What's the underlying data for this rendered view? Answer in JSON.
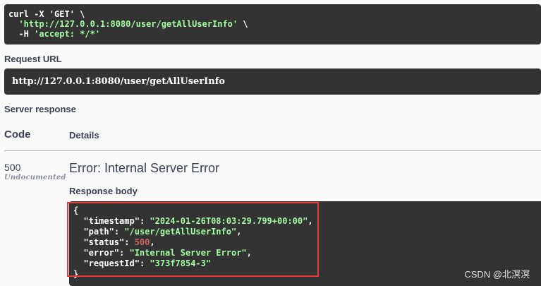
{
  "curl": {
    "line1": "curl -X 'GET' \\",
    "line2_url": "'http://127.0.0.1:8080/user/getAllUserInfo'",
    "line2_tail": " \\",
    "line3_flag": "-H ",
    "line3_header": "'accept: */*'"
  },
  "request_url": {
    "label": "Request URL",
    "value": "http://127.0.0.1:8080/user/getAllUserInfo"
  },
  "server_response": {
    "label": "Server response",
    "col_code": "Code",
    "col_details": "Details",
    "code": "500",
    "code_note": "Undocumented",
    "title": "Error: Internal Server Error",
    "body_label": "Response body",
    "body": {
      "open": "{",
      "timestamp_key": "\"timestamp\"",
      "timestamp_val": "\"2024-01-26T08:03:29.799+00:00\"",
      "path_key": "\"path\"",
      "path_val": "\"/user/getAllUserInfo\"",
      "status_key": "\"status\"",
      "status_val": "500",
      "error_key": "\"error\"",
      "error_val": "\"Internal Server Error\"",
      "requestid_key": "\"requestId\"",
      "requestid_val": "\"373f7854-3\"",
      "close": "}"
    }
  },
  "watermark": "CSDN @北溟溟",
  "colors": {
    "code_bg": "#333333",
    "string": "#a2fca2",
    "number": "#d36363",
    "highlight": "#e53935"
  }
}
